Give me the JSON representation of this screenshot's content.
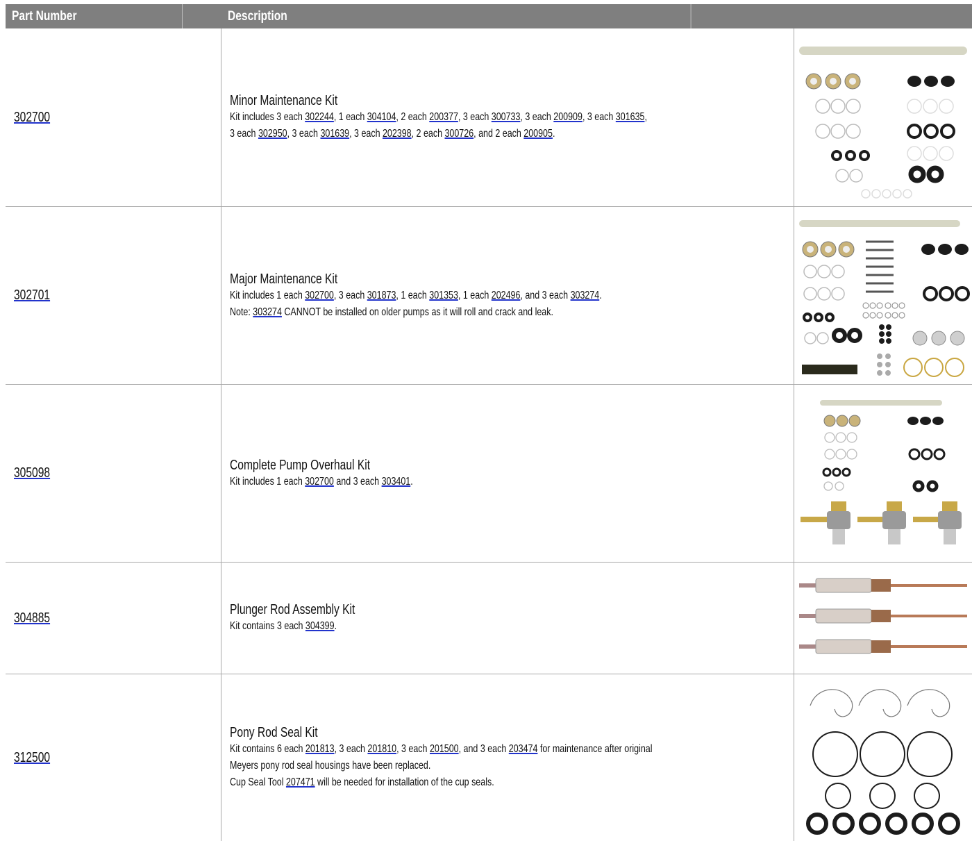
{
  "header": {
    "col_part": "Part Number",
    "col_desc": "Description",
    "col_image": ""
  },
  "rows": [
    {
      "part": "302700",
      "title": "Minor Maintenance Kit",
      "image_icon": "o-ring-kit-image",
      "lines": [
        [
          {
            "t": "Kit includes 3 each "
          },
          {
            "t": "302244",
            "link": true
          },
          {
            "t": ", 1 each "
          },
          {
            "t": "304104",
            "link": true
          },
          {
            "t": ", 2 each "
          },
          {
            "t": "200377",
            "link": true
          },
          {
            "t": ", 3 each "
          },
          {
            "t": "300733",
            "link": true
          },
          {
            "t": ", 3 each "
          },
          {
            "t": "200909",
            "link": true
          },
          {
            "t": ", 3 each "
          },
          {
            "t": "301635",
            "link": true
          },
          {
            "t": ","
          }
        ],
        [
          {
            "t": "3 each "
          },
          {
            "t": "302950",
            "link": true
          },
          {
            "t": ", 3 each "
          },
          {
            "t": "301639",
            "link": true
          },
          {
            "t": ", 3 each "
          },
          {
            "t": "202398",
            "link": true
          },
          {
            "t": ", 2 each "
          },
          {
            "t": "300726",
            "link": true
          },
          {
            "t": ", and 2 each "
          },
          {
            "t": "200905",
            "link": true
          },
          {
            "t": "."
          }
        ]
      ]
    },
    {
      "part": "302701",
      "title": "Major Maintenance Kit",
      "image_icon": "major-kit-image",
      "lines": [
        [
          {
            "t": "Kit includes 1 each "
          },
          {
            "t": "302700",
            "link": true
          },
          {
            "t": ", 3 each "
          },
          {
            "t": "301873",
            "link": true
          },
          {
            "t": ", 1 each "
          },
          {
            "t": "301353",
            "link": true
          },
          {
            "t": ", 1 each "
          },
          {
            "t": "202496",
            "link": true
          },
          {
            "t": ", and 3 each "
          },
          {
            "t": "303274",
            "link": true
          },
          {
            "t": "."
          }
        ],
        [
          {
            "t": "Note: "
          },
          {
            "t": "303274",
            "link": true
          },
          {
            "t": " CANNOT be installed on older pumps as it will roll and crack and leak."
          }
        ]
      ]
    },
    {
      "part": "305098",
      "title": "Complete Pump Overhaul Kit",
      "image_icon": "overhaul-kit-image",
      "lines": [
        [
          {
            "t": "Kit includes 1 each "
          },
          {
            "t": "302700",
            "link": true
          },
          {
            "t": " and 3 each "
          },
          {
            "t": "303401",
            "link": true
          },
          {
            "t": "."
          }
        ]
      ]
    },
    {
      "part": "304885",
      "title": "Plunger Rod Assembly Kit",
      "image_icon": "plunger-rod-image",
      "lines": [
        [
          {
            "t": "Kit contains 3 each "
          },
          {
            "t": "304399",
            "link": true
          },
          {
            "t": "."
          }
        ]
      ]
    },
    {
      "part": "312500",
      "title": "Pony Rod Seal Kit",
      "image_icon": "pony-rod-seal-image",
      "lines": [
        [
          {
            "t": "Kit contains 6 each "
          },
          {
            "t": "201813",
            "link": true
          },
          {
            "t": ", 3 each "
          },
          {
            "t": "201810",
            "link": true
          },
          {
            "t": ", 3 each "
          },
          {
            "t": "201500",
            "link": true
          },
          {
            "t": ", and 3 each "
          },
          {
            "t": "203474",
            "link": true
          },
          {
            "t": " for maintenance after original"
          }
        ],
        [
          {
            "t": "Meyers pony rod seal housings have been replaced."
          }
        ],
        [
          {
            "t": "Cup Seal Tool "
          },
          {
            "t": "207471",
            "link": true
          },
          {
            "t": " will be needed for installation of the cup seals."
          }
        ]
      ]
    }
  ]
}
